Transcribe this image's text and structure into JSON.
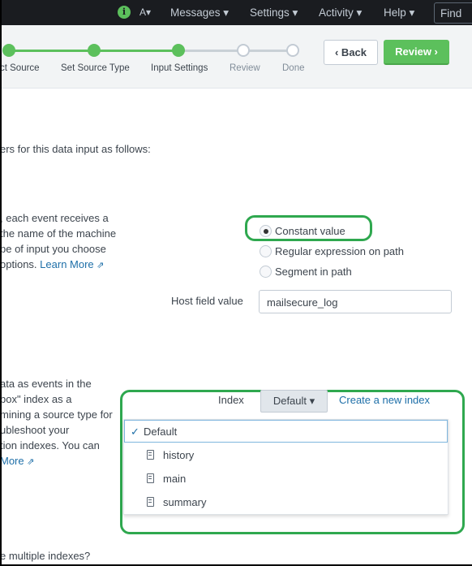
{
  "topbar": {
    "nav": [
      "Messages ▾",
      "Settings ▾",
      "Activity ▾",
      "Help ▾"
    ],
    "find": "Find",
    "info_icon": "i",
    "activity_icon": "A▾"
  },
  "steps": [
    {
      "label": "ct Source",
      "state": "done"
    },
    {
      "label": "Set Source Type",
      "state": "done"
    },
    {
      "label": "Input Settings",
      "state": "done"
    },
    {
      "label": "Review",
      "state": "todo"
    },
    {
      "label": "Done",
      "state": "todo"
    }
  ],
  "buttons": {
    "back": "‹ Back",
    "review": "Review ›"
  },
  "intro": "ers for this data input as follows:",
  "host": {
    "desc": [
      ", each event receives a",
      "the name of the machine",
      "pe of input you choose",
      "options."
    ],
    "learn_more": "Learn More",
    "options": [
      "Constant value",
      "Regular expression on path",
      "Segment in path"
    ],
    "selected": 0,
    "field_label": "Host field value",
    "field_value": "mailsecure_log"
  },
  "index": {
    "desc": [
      "ata as events in the",
      "box\" index as a",
      "mining a source type for",
      "ubleshoot your",
      "tion indexes. You can"
    ],
    "learn_more": "More",
    "label": "Index",
    "selected": "Default ▾",
    "create": "Create a new index",
    "options": [
      "Default",
      "history",
      "main",
      "summary"
    ],
    "check": "✓"
  },
  "footer_q": "e multiple indexes?",
  "colors": {
    "accent": "#5cc05c",
    "highlight": "#2fa84f",
    "link": "#1e6fa8",
    "topbar": "#1a1c20"
  }
}
